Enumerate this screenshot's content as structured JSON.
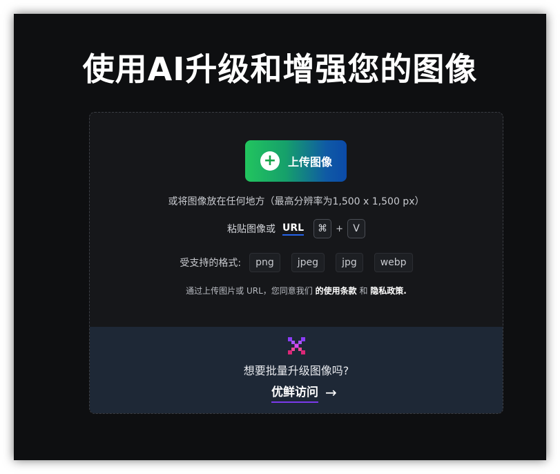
{
  "headline": "使用AI升级和增强您的图像",
  "upload": {
    "button_label": "上传图像",
    "plus_icon": "+",
    "drop_hint": "或将图像放在任何地方（最高分辨率为1,500 x 1,500 px）"
  },
  "paste": {
    "prefix": "粘贴图像或",
    "url_label": "URL",
    "key_cmd": "⌘",
    "plus": "+",
    "key_v": "V"
  },
  "formats": {
    "label": "受支持的格式:",
    "items": [
      "png",
      "jpeg",
      "jpg",
      "webp"
    ]
  },
  "terms": {
    "prefix": "通过上传图片或 URL，您同意我们",
    "terms_link": "的使用条款",
    "and": "和",
    "privacy_link": "隐私政策."
  },
  "bulk": {
    "question": "想要批量升级图像吗?",
    "link_label": "优鲜访问",
    "arrow": "→"
  },
  "colors": {
    "background": "#0e0f11",
    "card": "#16171a",
    "bulk_panel": "#1e2836",
    "button_gradient_start": "#22c55e",
    "button_gradient_end": "#0b4aa8",
    "url_underline": "#2563eb",
    "bulk_underline": "#7c3aed"
  }
}
